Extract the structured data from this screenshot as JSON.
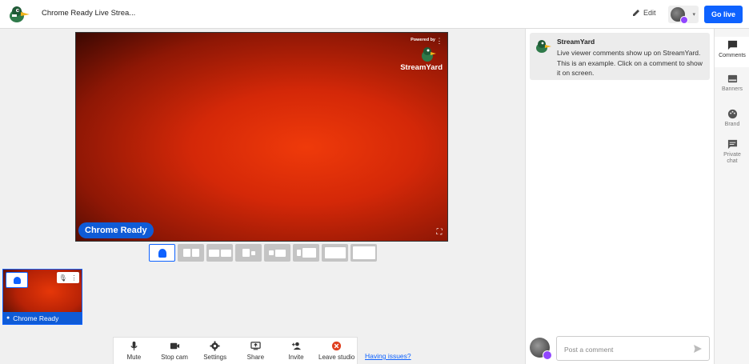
{
  "header": {
    "title": "Chrome Ready Live Strea...",
    "edit_label": "Edit",
    "golive_label": "Go live"
  },
  "stage": {
    "powered_by": "Powered by",
    "brand_name": "StreamYard",
    "participant_name": "Chrome Ready"
  },
  "thumbnail": {
    "participant_name": "Chrome Ready"
  },
  "toolbar": {
    "items": [
      {
        "label": "Mute",
        "icon": "mic-icon"
      },
      {
        "label": "Stop cam",
        "icon": "camera-icon"
      },
      {
        "label": "Settings",
        "icon": "gear-icon"
      },
      {
        "label": "Share",
        "icon": "share-screen-icon"
      },
      {
        "label": "Invite",
        "icon": "add-person-icon"
      },
      {
        "label": "Leave studio",
        "icon": "close-circle-icon"
      }
    ],
    "issues_link": "Having issues?"
  },
  "comments": {
    "sample": {
      "author": "StreamYard",
      "text": "Live viewer comments show up on StreamYard. This is an example. Click on a comment to show it on screen."
    },
    "input_placeholder": "Post a comment"
  },
  "rail": {
    "items": [
      {
        "label": "Comments",
        "icon": "comment-icon",
        "active": true
      },
      {
        "label": "Banners",
        "icon": "banner-icon",
        "active": false
      },
      {
        "label": "Brand",
        "icon": "palette-icon",
        "active": false
      },
      {
        "label": "Private chat",
        "icon": "chat-icon",
        "active": false
      }
    ]
  },
  "colors": {
    "accent": "#0e62ff",
    "leave": "#e0401f",
    "twitch": "#9146ff"
  }
}
